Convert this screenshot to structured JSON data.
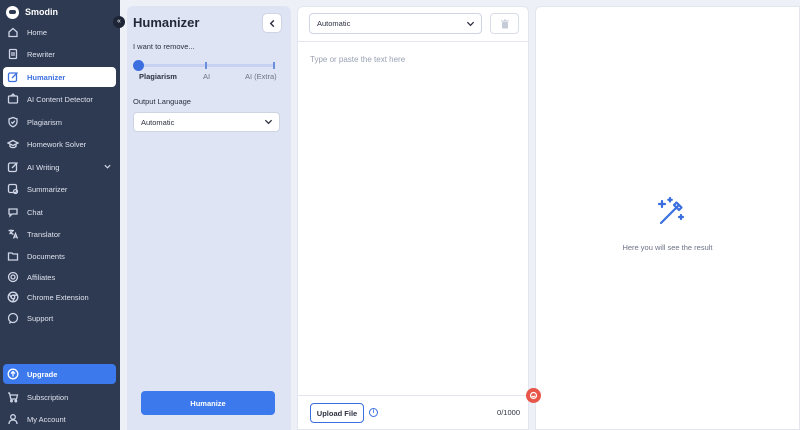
{
  "app": {
    "name": "Smodin"
  },
  "sidebar": {
    "items": [
      {
        "label": "Home",
        "icon": "home-icon"
      },
      {
        "label": "Rewriter",
        "icon": "rewriter-icon"
      },
      {
        "label": "Humanizer",
        "icon": "humanizer-icon",
        "active": true
      },
      {
        "label": "AI Content Detector",
        "icon": "detector-icon"
      },
      {
        "label": "Plagiarism",
        "icon": "shield-icon"
      },
      {
        "label": "Homework Solver",
        "icon": "graduation-cap-icon"
      },
      {
        "label": "AI Writing",
        "icon": "pen-icon",
        "expandable": true
      },
      {
        "label": "Summarizer",
        "icon": "summarizer-icon"
      },
      {
        "label": "Chat",
        "icon": "chat-icon"
      },
      {
        "label": "Translator",
        "icon": "translate-icon"
      },
      {
        "label": "Documents",
        "icon": "folder-icon"
      },
      {
        "label": "Affiliates",
        "icon": "affiliates-icon"
      },
      {
        "label": "Chrome Extension",
        "icon": "chrome-icon"
      },
      {
        "label": "Support",
        "icon": "support-icon"
      }
    ],
    "upgrade_label": "Upgrade",
    "subscription_label": "Subscription",
    "account_label": "My Account"
  },
  "settings": {
    "title": "Humanizer",
    "remove_label": "I want to remove...",
    "levels": [
      "Plagiarism",
      "AI",
      "AI (Extra)"
    ],
    "selected_level": "Plagiarism",
    "output_language_label": "Output Language",
    "output_language_value": "Automatic",
    "humanize_label": "Humanize"
  },
  "input": {
    "language_value": "Automatic",
    "placeholder": "Type or paste the text here",
    "upload_label": "Upload File",
    "char_count": "0/1000"
  },
  "result": {
    "empty_text": "Here you will see the result"
  },
  "colors": {
    "accent": "#3c79ec",
    "sidebar_bg": "#2e3952",
    "panel_bg": "#dfe4f5",
    "fab": "#e8564a"
  }
}
